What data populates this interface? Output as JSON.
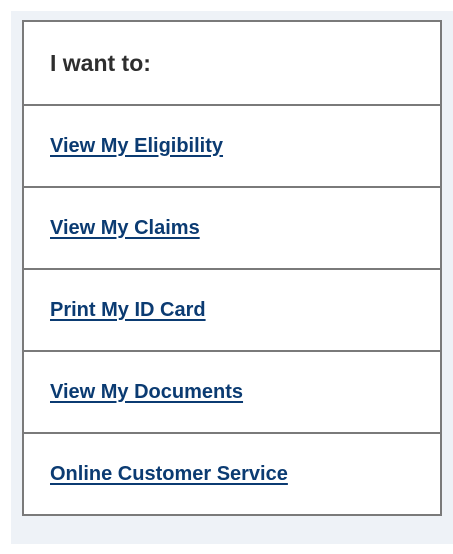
{
  "menu": {
    "heading": "I want to:",
    "items": [
      {
        "label": "View My Eligibility"
      },
      {
        "label": "View My Claims"
      },
      {
        "label": "Print My ID Card"
      },
      {
        "label": "View My Documents"
      },
      {
        "label": "Online Customer Service"
      }
    ]
  },
  "colors": {
    "link": "#0b3b72",
    "border": "#7a7a7a",
    "panel_background": "#eef2f7"
  }
}
